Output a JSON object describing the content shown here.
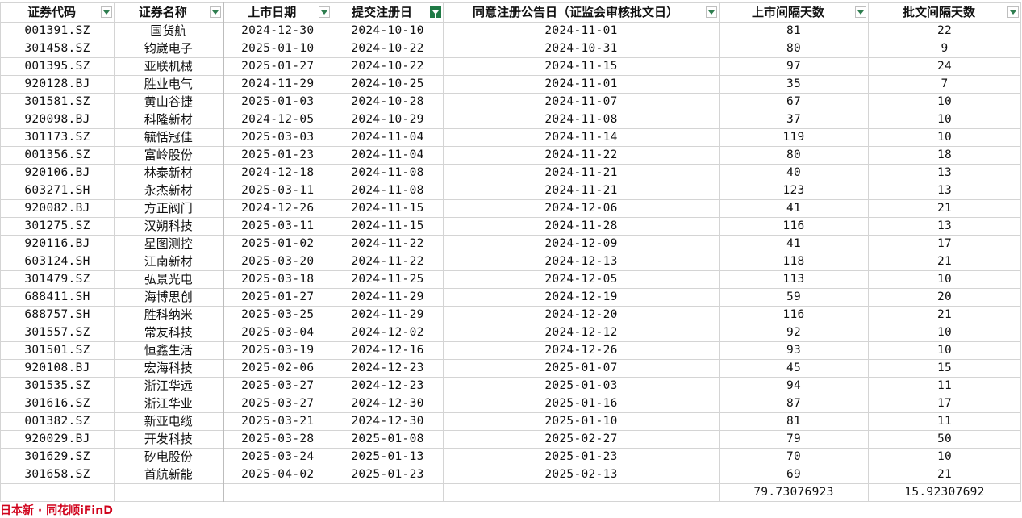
{
  "headers": [
    {
      "label": "证券代码",
      "filter_active": false
    },
    {
      "label": "证券名称",
      "filter_active": false
    },
    {
      "label": "上市日期",
      "filter_active": false
    },
    {
      "label": "提交注册日",
      "filter_active": true
    },
    {
      "label": "同意注册公告日（证监会审核批文日）",
      "filter_active": false
    },
    {
      "label": "上市间隔天数",
      "filter_active": false
    },
    {
      "label": "批文间隔天数",
      "filter_active": false
    }
  ],
  "rows": [
    [
      "001391.SZ",
      "国货航",
      "2024-12-30",
      "2024-10-10",
      "2024-11-01",
      "81",
      "22"
    ],
    [
      "301458.SZ",
      "钧崴电子",
      "2025-01-10",
      "2024-10-22",
      "2024-10-31",
      "80",
      "9"
    ],
    [
      "001395.SZ",
      "亚联机械",
      "2025-01-27",
      "2024-10-22",
      "2024-11-15",
      "97",
      "24"
    ],
    [
      "920128.BJ",
      "胜业电气",
      "2024-11-29",
      "2024-10-25",
      "2024-11-01",
      "35",
      "7"
    ],
    [
      "301581.SZ",
      "黄山谷捷",
      "2025-01-03",
      "2024-10-28",
      "2024-11-07",
      "67",
      "10"
    ],
    [
      "920098.BJ",
      "科隆新材",
      "2024-12-05",
      "2024-10-29",
      "2024-11-08",
      "37",
      "10"
    ],
    [
      "301173.SZ",
      "毓恬冠佳",
      "2025-03-03",
      "2024-11-04",
      "2024-11-14",
      "119",
      "10"
    ],
    [
      "001356.SZ",
      "富岭股份",
      "2025-01-23",
      "2024-11-04",
      "2024-11-22",
      "80",
      "18"
    ],
    [
      "920106.BJ",
      "林泰新材",
      "2024-12-18",
      "2024-11-08",
      "2024-11-21",
      "40",
      "13"
    ],
    [
      "603271.SH",
      "永杰新材",
      "2025-03-11",
      "2024-11-08",
      "2024-11-21",
      "123",
      "13"
    ],
    [
      "920082.BJ",
      "方正阀门",
      "2024-12-26",
      "2024-11-15",
      "2024-12-06",
      "41",
      "21"
    ],
    [
      "301275.SZ",
      "汉朔科技",
      "2025-03-11",
      "2024-11-15",
      "2024-11-28",
      "116",
      "13"
    ],
    [
      "920116.BJ",
      "星图测控",
      "2025-01-02",
      "2024-11-22",
      "2024-12-09",
      "41",
      "17"
    ],
    [
      "603124.SH",
      "江南新材",
      "2025-03-20",
      "2024-11-22",
      "2024-12-13",
      "118",
      "21"
    ],
    [
      "301479.SZ",
      "弘景光电",
      "2025-03-18",
      "2024-11-25",
      "2024-12-05",
      "113",
      "10"
    ],
    [
      "688411.SH",
      "海博思创",
      "2025-01-27",
      "2024-11-29",
      "2024-12-19",
      "59",
      "20"
    ],
    [
      "688757.SH",
      "胜科纳米",
      "2025-03-25",
      "2024-11-29",
      "2024-12-20",
      "116",
      "21"
    ],
    [
      "301557.SZ",
      "常友科技",
      "2025-03-04",
      "2024-12-02",
      "2024-12-12",
      "92",
      "10"
    ],
    [
      "301501.SZ",
      "恒鑫生活",
      "2025-03-19",
      "2024-12-16",
      "2024-12-26",
      "93",
      "10"
    ],
    [
      "920108.BJ",
      "宏海科技",
      "2025-02-06",
      "2024-12-23",
      "2025-01-07",
      "45",
      "15"
    ],
    [
      "301535.SZ",
      "浙江华远",
      "2025-03-27",
      "2024-12-23",
      "2025-01-03",
      "94",
      "11"
    ],
    [
      "301616.SZ",
      "浙江华业",
      "2025-03-27",
      "2024-12-30",
      "2025-01-16",
      "87",
      "17"
    ],
    [
      "001382.SZ",
      "新亚电缆",
      "2025-03-21",
      "2024-12-30",
      "2025-01-10",
      "81",
      "11"
    ],
    [
      "920029.BJ",
      "开发科技",
      "2025-03-28",
      "2025-01-08",
      "2025-02-27",
      "79",
      "50"
    ],
    [
      "301629.SZ",
      "矽电股份",
      "2025-03-24",
      "2025-01-13",
      "2025-01-23",
      "70",
      "10"
    ],
    [
      "301658.SZ",
      "首航新能",
      "2025-04-02",
      "2025-01-23",
      "2025-02-13",
      "69",
      "21"
    ]
  ],
  "summary": {
    "listing_avg": "79.73076923",
    "approval_avg": "15.92307692"
  },
  "colors": {
    "filter_active": "#1f7a45",
    "note_red": "#d0021b"
  }
}
